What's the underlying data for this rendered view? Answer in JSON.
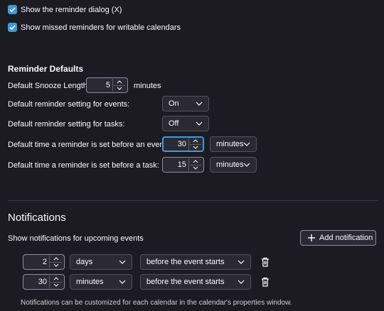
{
  "general": {
    "show_dialog_label": "Show the reminder dialog (X)",
    "show_missed_label": "Show missed reminders for writable calendars"
  },
  "defaults": {
    "heading": "Reminder Defaults",
    "snooze_label": "Default Snooze Length:",
    "snooze_value": "5",
    "snooze_unit": "minutes",
    "events_label": "Default reminder setting for events:",
    "events_value": "On",
    "tasks_label": "Default reminder setting for tasks:",
    "tasks_value": "Off",
    "before_event_label": "Default time a reminder is set before an event:",
    "before_event_value": "30",
    "before_event_unit": "minutes",
    "before_task_label": "Default time a reminder is set before a task:",
    "before_task_value": "15",
    "before_task_unit": "minutes"
  },
  "notifications": {
    "title": "Notifications",
    "show_label": "Show notifications for upcoming events",
    "add_button": "Add notification",
    "rows": [
      {
        "value": "2",
        "unit": "days",
        "relation": "before the event starts"
      },
      {
        "value": "30",
        "unit": "minutes",
        "relation": "before the event starts"
      }
    ],
    "footnote": "Notifications can be customized for each calendar in the calendar's properties window."
  },
  "colors": {
    "background": "#1c1b22",
    "accent": "#3d9ad9",
    "control": "#2b2a33"
  },
  "icons": {
    "checkbox": "checkmark-icon",
    "spinner": "chevron-up-down-icon",
    "dropdown": "chevron-down-icon",
    "add": "plus-icon",
    "delete": "trash-icon"
  }
}
